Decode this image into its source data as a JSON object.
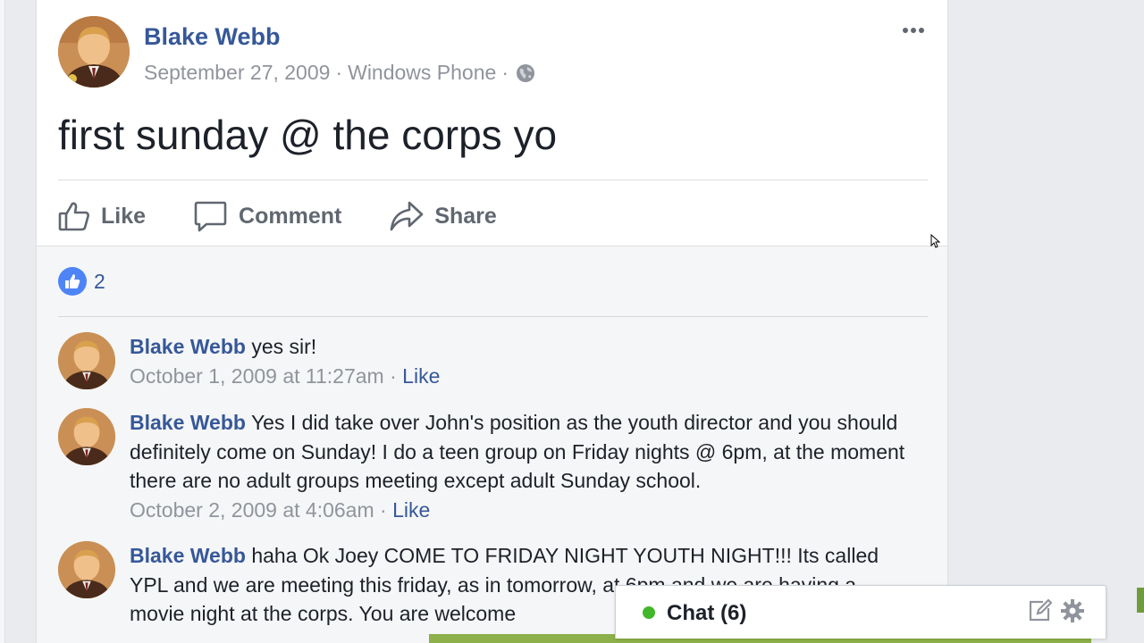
{
  "post": {
    "author": "Blake Webb",
    "date": "September 27, 2009",
    "source": "Windows Phone",
    "separator": "·",
    "text": "first sunday @ the corps yo",
    "privacy_icon": "globe-icon",
    "more_icon": "more-options-icon"
  },
  "actions": {
    "like": "Like",
    "comment": "Comment",
    "share": "Share"
  },
  "reactions": {
    "count": "2",
    "icon": "thumbs-up-icon"
  },
  "comments": [
    {
      "author": "Blake Webb",
      "text": "yes sir!",
      "timestamp": "October 1, 2009 at 11:27am",
      "like_label": "Like"
    },
    {
      "author": "Blake Webb",
      "text": "Yes I did take over John's position as the youth director and you should definitely come on Sunday! I do a teen group on Friday nights @ 6pm, at the moment there are no adult groups meeting except adult Sunday school.",
      "timestamp": "October 2, 2009 at 4:06am",
      "like_label": "Like"
    },
    {
      "author": "Blake Webb",
      "text": "haha Ok Joey COME TO FRIDAY NIGHT YOUTH NIGHT!!! Its called YPL and we are meeting this friday, as in tomorrow, at 6pm and we are having a movie night at the corps. You are welcome",
      "timestamp": "",
      "like_label": ""
    }
  ],
  "chat": {
    "label": "Chat (6)",
    "status_color": "#42b72a",
    "compose_icon": "compose-icon",
    "settings_icon": "gear-icon"
  },
  "colors": {
    "link": "#365899",
    "meta": "#90949c",
    "action": "#606770",
    "like_badge": "#4e84f6"
  }
}
